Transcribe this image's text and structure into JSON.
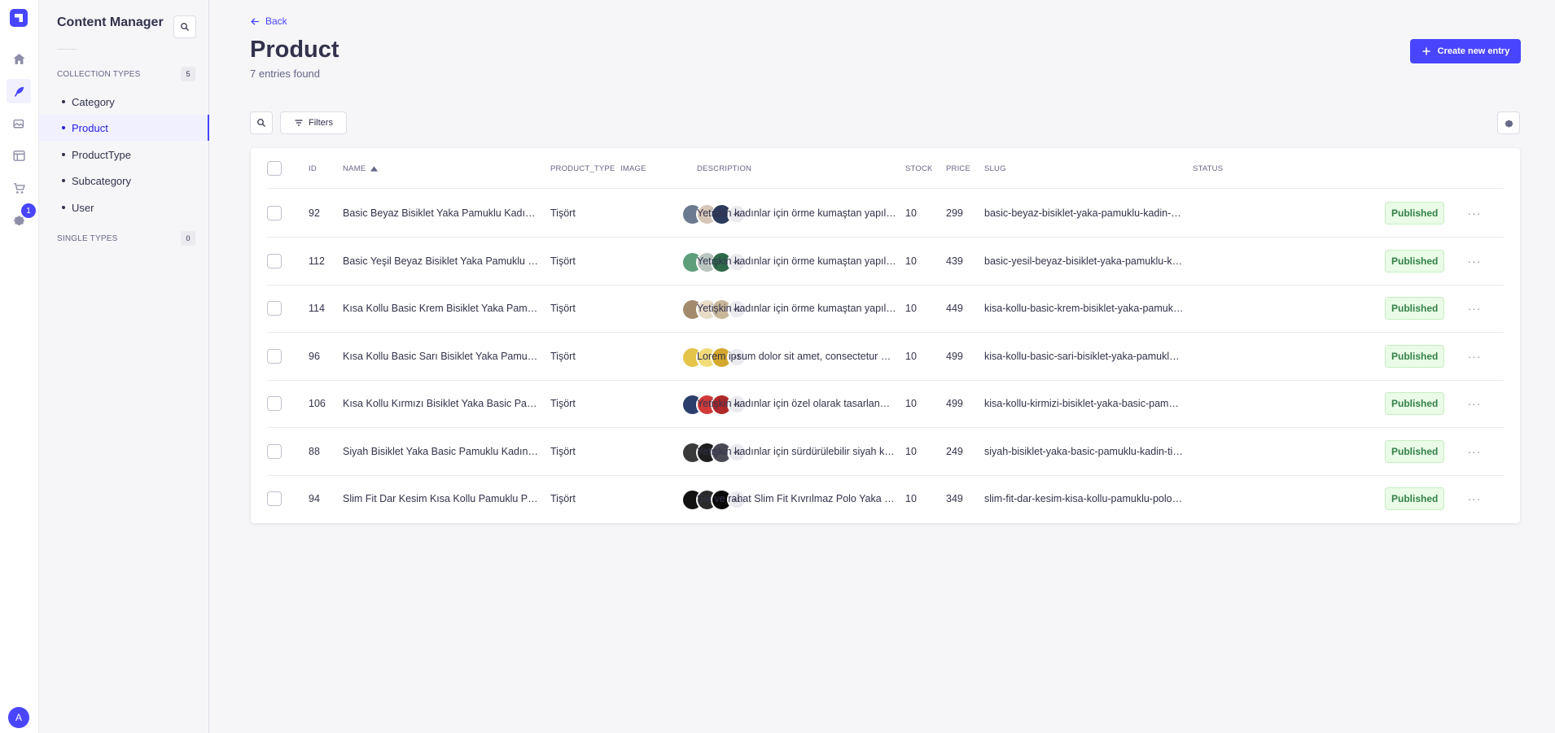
{
  "rail": {
    "badge_count": "1",
    "avatar_initial": "A",
    "items": [
      "home-icon",
      "feather-icon",
      "images-icon",
      "layout-icon",
      "cart-icon",
      "gear-icon"
    ]
  },
  "subnav": {
    "title": "Content Manager",
    "collection_types_label": "COLLECTION TYPES",
    "collection_types_count": "5",
    "collection_items": [
      {
        "label": "Category",
        "active": false
      },
      {
        "label": "Product",
        "active": true
      },
      {
        "label": "ProductType",
        "active": false
      },
      {
        "label": "Subcategory",
        "active": false
      },
      {
        "label": "User",
        "active": false
      }
    ],
    "single_types_label": "SINGLE TYPES",
    "single_types_count": "0"
  },
  "header": {
    "back_label": "Back",
    "title": "Product",
    "subtitle": "7 entries found",
    "create_label": "Create new entry"
  },
  "toolbar": {
    "filters_label": "Filters"
  },
  "table": {
    "columns": {
      "id": "ID",
      "name": "NAME",
      "product_type": "PRODUCT_TYPE",
      "image": "IMAGE",
      "description": "DESCRIPTION",
      "stock": "STOCK",
      "price": "PRICE",
      "slug": "SLUG",
      "status": "STATUS"
    },
    "rows": [
      {
        "id": "92",
        "name": "Basic Beyaz Bisiklet Yaka Pamuklu Kadın Tişört",
        "product_type": "Tişört",
        "image_more": "+1",
        "description": "Yetişkin kadınlar için örme kumaştan yapılmış k...",
        "stock": "10",
        "price": "299",
        "slug": "basic-beyaz-bisiklet-yaka-pamuklu-kadin-tisort",
        "status": "Published",
        "thumbs": [
          "#6b7a8f",
          "#d7c7b8",
          "#2d3b5c"
        ]
      },
      {
        "id": "112",
        "name": "Basic Yeşil Beyaz Bisiklet Yaka Pamuklu Kadın Ti...",
        "product_type": "Tişört",
        "image_more": "+1",
        "description": "Yetişkin kadınlar için örme kumaştan yapılmış k...",
        "stock": "10",
        "price": "439",
        "slug": "basic-yesil-beyaz-bisiklet-yaka-pamuklu-kadin...",
        "status": "Published",
        "thumbs": [
          "#5e9e7a",
          "#b9c7c0",
          "#2f6b4a"
        ]
      },
      {
        "id": "114",
        "name": "Kısa Kollu Basic Krem Bisiklet Yaka Pamuklu Ka...",
        "product_type": "Tişört",
        "image_more": "+1",
        "description": "Yetişkin kadınlar için örme kumaştan yapılmış k...",
        "stock": "10",
        "price": "449",
        "slug": "kisa-kollu-basic-krem-bisiklet-yaka-pamuklu-k...",
        "status": "Published",
        "thumbs": [
          "#a38a6c",
          "#e8dcc8",
          "#c9b79a"
        ]
      },
      {
        "id": "96",
        "name": "Kısa Kollu Basic Sarı Bisiklet Yaka Pamuklu Erke...",
        "product_type": "Tişört",
        "image_more": "+1",
        "description": "Lorem ipsum dolor sit amet, consectetur adipis...",
        "stock": "10",
        "price": "499",
        "slug": "kisa-kollu-basic-sari-bisiklet-yaka-pamuklu-erk...",
        "status": "Published",
        "thumbs": [
          "#e5c44a",
          "#f2dc7a",
          "#d4a82c"
        ]
      },
      {
        "id": "106",
        "name": "Kısa Kollu Kırmızı Bisiklet Yaka Basic Pamuklu K...",
        "product_type": "Tişört",
        "image_more": "+1",
        "description": "Yetişkin kadınlar için özel olarak tasarlanmış sü...",
        "stock": "10",
        "price": "499",
        "slug": "kisa-kollu-kirmizi-bisiklet-yaka-basic-pamuklu-...",
        "status": "Published",
        "thumbs": [
          "#2c3e6b",
          "#d23a3a",
          "#b02828"
        ]
      },
      {
        "id": "88",
        "name": "Siyah Bisiklet Yaka Basic Pamuklu Kadın Tişört",
        "product_type": "Tişört",
        "image_more": "+1",
        "description": "Yetişkin kadınlar için sürdürülebilir siyah kısa k...",
        "stock": "10",
        "price": "249",
        "slug": "siyah-bisiklet-yaka-basic-pamuklu-kadin-tisort",
        "status": "Published",
        "thumbs": [
          "#3a3a3a",
          "#1e1e1e",
          "#4a4a55"
        ]
      },
      {
        "id": "94",
        "name": "Slim Fit Dar Kesim Kısa Kollu Pamuklu Polo Tişört",
        "product_type": "Tişört",
        "image_more": "+1",
        "description": "Şık ve rahat Slim Fit Kıvrılmaz Polo Yaka Kol Ba...",
        "stock": "10",
        "price": "349",
        "slug": "slim-fit-dar-kesim-kisa-kollu-pamuklu-polo-tis...",
        "status": "Published",
        "thumbs": [
          "#111111",
          "#2a2a2a",
          "#0a0a0a"
        ]
      }
    ]
  },
  "colors": {
    "primary": "#4945ff",
    "published_bg": "#eafbe7",
    "published_text": "#328048"
  }
}
